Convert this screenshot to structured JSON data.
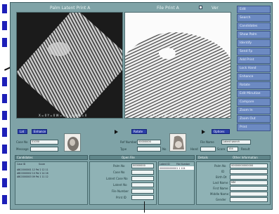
{
  "left_image": {
    "title": "Palm Latent Print A",
    "coords": "X = 0  Y = 0  W = 0  H = 0  Wait = 0"
  },
  "right_image": {
    "title": "File Print A",
    "coords": "X = 0  Y = 0  W = 0  H = 0  Wait = 0"
  },
  "top_right": {
    "label": "Ver"
  },
  "right_buttons": [
    "Edit",
    "Search",
    "Candidates",
    "Show Palm",
    "Identify",
    "Send Fp",
    "Add Print",
    "Lock Hand",
    "Enhance",
    "Rotate",
    "Edit Minutiae",
    "Compare",
    "Zoom In",
    "Zoom Out",
    "Print"
  ],
  "toolbar": {
    "b1": "Lat",
    "b2": "Enhance",
    "b3": "Rotate",
    "b4": "Options"
  },
  "form_left": {
    "case_label": "Case No",
    "case_value": "01030",
    "message_label": "Message"
  },
  "form_mid": {
    "ref_label": "Ref Number",
    "ref_value": "00000000",
    "type_label": "Type",
    "type_value": "",
    "no_label": "No"
  },
  "form_right": {
    "id_label": "File Name",
    "id_value": "Latent search",
    "finger_label": "Hand",
    "finger_value": "",
    "score_label": "Score",
    "score_value": "104",
    "result_label": "Result"
  },
  "panels": {
    "left_title": "Candidates",
    "mid_title": "",
    "mid_sub": "Open File",
    "right_title": "Details",
    "right_sub": "Other Information"
  },
  "left_list": {
    "headers": [
      "Case ID",
      "Score"
    ],
    "rows": [
      "ABC0000001  12  Pal  2 12 11",
      "ABC0000002  10  Pal  2 14 16",
      "ABC0000003  09  Pal  1 11 12"
    ]
  },
  "mid_fields": [
    "Palm No",
    "Case No",
    "Latent Case No",
    "Latent No",
    "File Number",
    "Print ID"
  ],
  "mid_values": [
    "00000000",
    "",
    "",
    "",
    "",
    ""
  ],
  "mid_list": {
    "headers": [
      "Latent ID",
      "File Number"
    ],
    "rows": [
      "0000000000001    1  104"
    ]
  },
  "right_fields": [
    "Palm No",
    "ID",
    "Birth Dt",
    "Last Name",
    "First Name",
    "Middle Name",
    "Gender"
  ],
  "right_values": [
    "00000000000000",
    "",
    "",
    "MM",
    "",
    "",
    ""
  ]
}
